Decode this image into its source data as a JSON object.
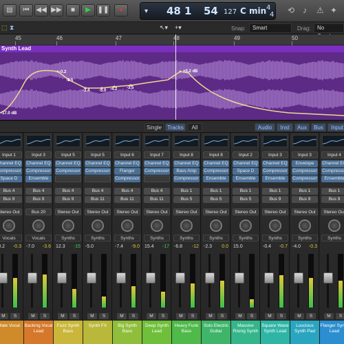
{
  "transport": {
    "bars": "48",
    "beat": "1",
    "tempo": "54",
    "tempo2": "127",
    "key": "C min",
    "sig_top": "4",
    "sig_bot": "4"
  },
  "toolstrip": {
    "snap_label": "Snap:",
    "snap_value": "Smart",
    "drag_label": "Drag:",
    "drag_value": "No Overlap"
  },
  "ruler": {
    "bar_numbers": [
      "45",
      "46",
      "47",
      "48",
      "49",
      "50"
    ]
  },
  "region": {
    "name": "Synth Lead",
    "automation_labels": [
      "-0.2",
      "-3.5",
      "-3.4",
      "-5.0",
      "-4.2",
      "-3.5",
      "+0.2 dB",
      "-17.0 dB"
    ]
  },
  "mixer": {
    "view_buttons": [
      "Single",
      "Tracks",
      "All"
    ],
    "filter_buttons": [
      "Audio",
      "Inst",
      "Aux",
      "Bus",
      "Input"
    ]
  },
  "strips": [
    {
      "name": "Male Vocal",
      "input": "Input 1",
      "fx": [
        "Channel EQ",
        "Compressor",
        "Space D"
      ],
      "sends": [
        "Bus 4",
        "Bus 9"
      ],
      "out": "Stereo Out",
      "group": "Vocals",
      "vol": "-0.2",
      "peak": "-0.3",
      "peak_green": false,
      "color": "#cf8a2a",
      "meter": 0.55
    },
    {
      "name": "Backing Vocal Lead",
      "input": "Input 3",
      "fx": [
        "Channel EQ",
        "Compressor",
        "Ensemble"
      ],
      "sends": [
        "Bus 4",
        "Bus 9"
      ],
      "out": "Bus 20",
      "group": "Vocals",
      "vol": "-7.0",
      "peak": "-3.6",
      "peak_green": false,
      "color": "#d6782a",
      "meter": 0.62
    },
    {
      "name": "Fuzz Synth Bass",
      "input": "Input 5",
      "fx": [
        "Channel EQ",
        "Compressor",
        ""
      ],
      "sends": [
        "Bus 4",
        "Bus 9"
      ],
      "out": "Stereo Out",
      "group": "Synths",
      "vol": "12.3",
      "peak": "-15",
      "peak_green": true,
      "color": "#c9b63a",
      "meter": 0.35
    },
    {
      "name": "Synth FX",
      "input": "Input 5",
      "fx": [
        "Channel EQ",
        "Compressor",
        ""
      ],
      "sends": [
        "Bus 4",
        "Bus 11"
      ],
      "out": "Stereo Out",
      "group": "Synths",
      "vol": "-5.0",
      "peak": "",
      "peak_green": false,
      "color": "#b9b83a",
      "meter": 0.2
    },
    {
      "name": "Big Synth Bass",
      "input": "Input 6",
      "fx": [
        "Channel EQ",
        "Flanger",
        "Compressor"
      ],
      "sends": [
        "Bus 4",
        "Bus 11"
      ],
      "out": "Stereo Out",
      "group": "Synths",
      "vol": "-7.4",
      "peak": "-9.0",
      "peak_green": false,
      "color": "#8fbf3a",
      "meter": 0.4
    },
    {
      "name": "Deep Synth Lead",
      "input": "Input 7",
      "fx": [
        "Channel EQ",
        "Compressor",
        ""
      ],
      "sends": [
        "Bus 4",
        "Bus 11"
      ],
      "out": "Stereo Out",
      "group": "Synths",
      "vol": "15.4",
      "peak": "-17",
      "peak_green": true,
      "color": "#6fbf3a",
      "meter": 0.3
    },
    {
      "name": "Heavy Funk Bass",
      "input": "Input 8",
      "fx": [
        "Channel EQ",
        "Bass Amp",
        "Compressor"
      ],
      "sends": [
        "Bus 1",
        "Bus 5"
      ],
      "out": "Stereo Out",
      "group": "Synths",
      "vol": "-6.8",
      "peak": "-12",
      "peak_green": false,
      "color": "#4fb94a",
      "meter": 0.45
    },
    {
      "name": "Solo Electric Guitar",
      "input": "Input 8",
      "fx": [
        "Channel EQ",
        "Compressor",
        "Ensemble"
      ],
      "sends": [
        "Bus 1",
        "Bus 5"
      ],
      "out": "Stereo Out",
      "group": "Synths",
      "vol": "-2.3",
      "peak": "0.0",
      "peak_green": false,
      "color": "#3fb56a",
      "meter": 0.5
    },
    {
      "name": "Massive Rising Synth",
      "input": "Input 2",
      "fx": [
        "Channel EQ",
        "Space D",
        "Ensemble"
      ],
      "sends": [
        "Bus 1",
        "Bus 5"
      ],
      "out": "Stereo Out",
      "group": "Synths",
      "vol": "15.0",
      "peak": "",
      "peak_green": false,
      "color": "#35b58a",
      "meter": 0.15
    },
    {
      "name": "Square Wave Synth Lead",
      "input": "Input 3",
      "fx": [
        "Channel EQ",
        "Compressor",
        "Ensemble"
      ],
      "sends": [
        "Bus 1",
        "Bus 9"
      ],
      "out": "Stereo Out",
      "group": "Synths",
      "vol": "-0.4",
      "peak": "-0.7",
      "peak_green": false,
      "color": "#2fb5a5",
      "meter": 0.6
    },
    {
      "name": "Luscious Synth Pad",
      "input": "Input 3",
      "fx": [
        "Envelope",
        "Compressor",
        "Compressor"
      ],
      "sends": [
        "Bus 1",
        "Bus 9"
      ],
      "out": "Stereo Out",
      "group": "Synths",
      "vol": "-4.0",
      "peak": "-0.3",
      "peak_green": false,
      "color": "#2aa5c0",
      "meter": 0.55
    },
    {
      "name": "Flanger Synth Lead",
      "input": "Input 4",
      "fx": [
        "Channel EQ",
        "Compressor",
        "Ensemble"
      ],
      "sends": [
        "Bus 1",
        "Bus 9"
      ],
      "out": "Stereo Out",
      "group": "Synths",
      "vol": "",
      "peak": "",
      "peak_green": false,
      "color": "#2a8ed0",
      "meter": 0.5
    }
  ],
  "icons": {
    "rewind": "rewind-icon",
    "back": "back-icon",
    "forward": "forward-icon",
    "stop": "stop-icon",
    "play": "play-icon",
    "pause": "pause-icon",
    "record": "record-icon"
  }
}
